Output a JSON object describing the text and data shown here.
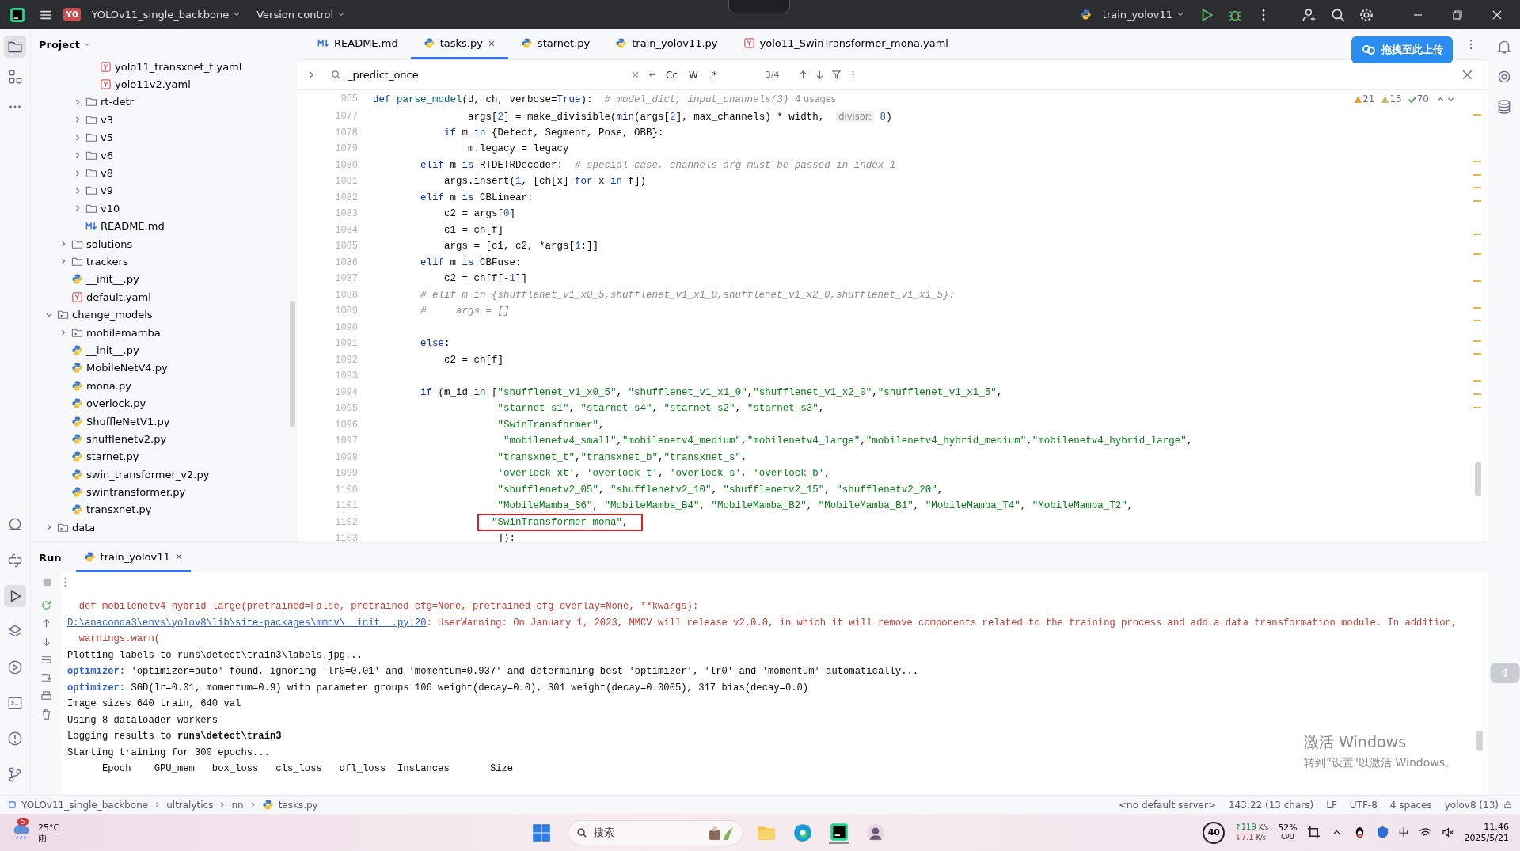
{
  "titlebar": {
    "project_badge": "Y0",
    "project": "YOLOv11_single_backbone",
    "vcs": "Version control",
    "run_config": "train_yolov11"
  },
  "project_panel": {
    "title": "Project",
    "tree": [
      {
        "children": [
          {
            "children": [
              {
                "children": [
                  {
                    "name": "yolo11_transxnet_t.yaml",
                    "kind": "yaml"
                  },
                  {
                    "name": "yolo11v2.yaml",
                    "kind": "yaml"
                  }
                ]
              },
              {
                "name": "rt-detr",
                "kind": "folder",
                "expanded": false
              },
              {
                "name": "v3",
                "kind": "folder",
                "expanded": false
              },
              {
                "name": "v5",
                "kind": "folder",
                "expanded": false
              },
              {
                "name": "v6",
                "kind": "folder",
                "expanded": false
              },
              {
                "name": "v8",
                "kind": "folder",
                "expanded": false
              },
              {
                "name": "v9",
                "kind": "folder",
                "expanded": false
              },
              {
                "name": "v10",
                "kind": "folder",
                "expanded": false
              },
              {
                "name": "README.md",
                "kind": "markdown"
              }
            ]
          },
          {
            "name": "solutions",
            "kind": "folder",
            "expanded": false
          },
          {
            "name": "trackers",
            "kind": "folder",
            "expanded": false
          },
          {
            "name": "__init__.py",
            "kind": "python"
          },
          {
            "name": "default.yaml",
            "kind": "yaml"
          }
        ]
      },
      {
        "name": "change_models",
        "kind": "package",
        "expanded": true,
        "children": [
          {
            "name": "mobilemamba",
            "kind": "package",
            "expanded": false
          },
          {
            "name": "__init__.py",
            "kind": "python"
          },
          {
            "name": "MobileNetV4.py",
            "kind": "python"
          },
          {
            "name": "mona.py",
            "kind": "python"
          },
          {
            "name": "overlock.py",
            "kind": "python"
          },
          {
            "name": "ShuffleNetV1.py",
            "kind": "python"
          },
          {
            "name": "shufflenetv2.py",
            "kind": "python"
          },
          {
            "name": "starnet.py",
            "kind": "python"
          },
          {
            "name": "swin_transformer_v2.py",
            "kind": "python"
          },
          {
            "name": "swintransformer.py",
            "kind": "python"
          },
          {
            "name": "transxnet.py",
            "kind": "python"
          }
        ]
      },
      {
        "name": "data",
        "kind": "package",
        "expanded": false
      }
    ]
  },
  "tabs": [
    {
      "label": "README.md",
      "kind": "markdown",
      "selected": false
    },
    {
      "label": "tasks.py",
      "kind": "python",
      "selected": true
    },
    {
      "label": "starnet.py",
      "kind": "python",
      "selected": false
    },
    {
      "label": "train_yolov11.py",
      "kind": "python",
      "selected": false
    },
    {
      "label": "yolo11_SwinTransformer_mona.yaml",
      "kind": "yaml",
      "selected": false
    }
  ],
  "upload_button": "拖拽至此上传",
  "find": {
    "value": "_predict_once",
    "match_case": "Cc",
    "words": "W",
    "regex": ".*",
    "count": "3/4"
  },
  "inspections": {
    "errors": "21",
    "warnings": "15",
    "typos": "70"
  },
  "sticky_line": {
    "number": "955",
    "tokens": [
      {
        "kind": "k",
        "text": "def "
      },
      {
        "kind": "f",
        "text": "parse_model"
      },
      {
        "kind": "p",
        "text": "(d, ch, verbose="
      },
      {
        "kind": "k",
        "text": "True"
      },
      {
        "kind": "p",
        "text": "):  "
      },
      {
        "kind": "c",
        "text": "# model_dict, input_channels(3)"
      },
      {
        "kind": "u",
        "text": "4 usages"
      }
    ]
  },
  "code_lines": [
    {
      "number": "1077",
      "tokens": [
        {
          "kind": "p",
          "text": "                args["
        },
        {
          "kind": "n",
          "text": "2"
        },
        {
          "kind": "p",
          "text": "] = make_divisible("
        },
        {
          "kind": "b",
          "text": "min"
        },
        {
          "kind": "p",
          "text": "(args["
        },
        {
          "kind": "n",
          "text": "2"
        },
        {
          "kind": "p",
          "text": "], max_channels) * width,  "
        },
        {
          "kind": "h",
          "text": "divisor:"
        },
        {
          "kind": "n",
          "text": " 8"
        },
        {
          "kind": "p",
          "text": ")"
        }
      ]
    },
    {
      "number": "1078",
      "tokens": [
        {
          "kind": "k",
          "text": "            if "
        },
        {
          "kind": "p",
          "text": "m "
        },
        {
          "kind": "k",
          "text": "in "
        },
        {
          "kind": "p",
          "text": "{Detect, Segment, Pose, OBB}:"
        }
      ]
    },
    {
      "number": "1079",
      "tokens": [
        {
          "kind": "p",
          "text": "                m.legacy = legacy"
        }
      ]
    },
    {
      "number": "1080",
      "tokens": [
        {
          "kind": "k",
          "text": "        elif "
        },
        {
          "kind": "p",
          "text": "m "
        },
        {
          "kind": "k",
          "text": "is "
        },
        {
          "kind": "p",
          "text": "RTDETRDecoder:  "
        },
        {
          "kind": "c",
          "text": "# special case, channels arg must be passed in index 1"
        }
      ]
    },
    {
      "number": "1081",
      "tokens": [
        {
          "kind": "p",
          "text": "            args.insert("
        },
        {
          "kind": "n",
          "text": "1"
        },
        {
          "kind": "p",
          "text": ", [ch[x] "
        },
        {
          "kind": "k",
          "text": "for "
        },
        {
          "kind": "p",
          "text": "x "
        },
        {
          "kind": "k",
          "text": "in "
        },
        {
          "kind": "p",
          "text": "f])"
        }
      ]
    },
    {
      "number": "1082",
      "tokens": [
        {
          "kind": "k",
          "text": "        elif "
        },
        {
          "kind": "p",
          "text": "m "
        },
        {
          "kind": "k",
          "text": "is "
        },
        {
          "kind": "p",
          "text": "CBLinear:"
        }
      ]
    },
    {
      "number": "1083",
      "tokens": [
        {
          "kind": "p",
          "text": "            c2 = args["
        },
        {
          "kind": "n",
          "text": "0"
        },
        {
          "kind": "p",
          "text": "]"
        }
      ]
    },
    {
      "number": "1084",
      "tokens": [
        {
          "kind": "p",
          "text": "            c1 = ch[f]"
        }
      ]
    },
    {
      "number": "1085",
      "tokens": [
        {
          "kind": "p",
          "text": "            args = [c1, c2, *args["
        },
        {
          "kind": "n",
          "text": "1"
        },
        {
          "kind": "p",
          "text": ":]]"
        }
      ]
    },
    {
      "number": "1086",
      "tokens": [
        {
          "kind": "k",
          "text": "        elif "
        },
        {
          "kind": "p",
          "text": "m "
        },
        {
          "kind": "k",
          "text": "is "
        },
        {
          "kind": "p",
          "text": "CBFuse:"
        }
      ]
    },
    {
      "number": "1087",
      "tokens": [
        {
          "kind": "p",
          "text": "            c2 = ch[f[-"
        },
        {
          "kind": "n",
          "text": "1"
        },
        {
          "kind": "p",
          "text": "]]"
        }
      ]
    },
    {
      "number": "1088",
      "tokens": [
        {
          "kind": "c",
          "text": "        # elif m in {shufflenet_v1_x0_5,shufflenet_v1_x1_0,shufflenet_v1_x2_0,shufflenet_v1_x1_5}:"
        }
      ]
    },
    {
      "number": "1089",
      "tokens": [
        {
          "kind": "c",
          "text": "        #     args = []"
        }
      ]
    },
    {
      "number": "1090"
    },
    {
      "number": "1091",
      "tokens": [
        {
          "kind": "k",
          "text": "        else"
        },
        {
          "kind": "p",
          "text": ":"
        }
      ]
    },
    {
      "number": "1092",
      "tokens": [
        {
          "kind": "p",
          "text": "            c2 = ch[f]"
        }
      ]
    },
    {
      "number": "1093"
    },
    {
      "number": "1094",
      "tokens": [
        {
          "kind": "k",
          "text": "        if "
        },
        {
          "kind": "p",
          "text": "(m_id "
        },
        {
          "kind": "k",
          "text": "in "
        },
        {
          "kind": "p",
          "text": "["
        },
        {
          "kind": "s",
          "text": "\"shufflenet_v1_x0_5\""
        },
        {
          "kind": "p",
          "text": ", "
        },
        {
          "kind": "s",
          "text": "\"shufflenet_v1_x1_0\""
        },
        {
          "kind": "p",
          "text": ","
        },
        {
          "kind": "s",
          "text": "\"shufflenet_v1_x2_0\""
        },
        {
          "kind": "p",
          "text": ","
        },
        {
          "kind": "s",
          "text": "\"shufflenet_v1_x1_5\""
        },
        {
          "kind": "p",
          "text": ","
        }
      ]
    },
    {
      "number": "1095",
      "tokens": [
        {
          "kind": "s",
          "text": "                     \"starnet_s1\""
        },
        {
          "kind": "p",
          "text": ", "
        },
        {
          "kind": "s",
          "text": "\"starnet_s4\""
        },
        {
          "kind": "p",
          "text": ", "
        },
        {
          "kind": "s",
          "text": "\"starnet_s2\""
        },
        {
          "kind": "p",
          "text": ", "
        },
        {
          "kind": "s",
          "text": "\"starnet_s3\""
        },
        {
          "kind": "p",
          "text": ","
        }
      ]
    },
    {
      "number": "1096",
      "tokens": [
        {
          "kind": "s",
          "text": "                     \"SwinTransformer\""
        },
        {
          "kind": "p",
          "text": ","
        }
      ]
    },
    {
      "number": "1097",
      "tokens": [
        {
          "kind": "s",
          "text": "                      \"mobilenetv4_small\""
        },
        {
          "kind": "p",
          "text": ","
        },
        {
          "kind": "s",
          "text": "\"mobilenetv4_medium\""
        },
        {
          "kind": "p",
          "text": ","
        },
        {
          "kind": "s",
          "text": "\"mobilenetv4_large\""
        },
        {
          "kind": "p",
          "text": ","
        },
        {
          "kind": "s",
          "text": "\"mobilenetv4_hybrid_medium\""
        },
        {
          "kind": "p",
          "text": ","
        },
        {
          "kind": "s",
          "text": "\"mobilenetv4_hybrid_large\""
        },
        {
          "kind": "p",
          "text": ","
        }
      ]
    },
    {
      "number": "1098",
      "tokens": [
        {
          "kind": "s",
          "text": "                     \"transxnet_t\""
        },
        {
          "kind": "p",
          "text": ","
        },
        {
          "kind": "s",
          "text": "\"transxnet_b\""
        },
        {
          "kind": "p",
          "text": ","
        },
        {
          "kind": "s",
          "text": "\"transxnet_s\""
        },
        {
          "kind": "p",
          "text": ","
        }
      ]
    },
    {
      "number": "1099",
      "tokens": [
        {
          "kind": "s",
          "text": "                     'overlock_xt'"
        },
        {
          "kind": "p",
          "text": ", "
        },
        {
          "kind": "s",
          "text": "'overlock_t'"
        },
        {
          "kind": "p",
          "text": ", "
        },
        {
          "kind": "s",
          "text": "'overlock_s'"
        },
        {
          "kind": "p",
          "text": ", "
        },
        {
          "kind": "s",
          "text": "'overlock_b'"
        },
        {
          "kind": "p",
          "text": ","
        }
      ]
    },
    {
      "number": "1100",
      "tokens": [
        {
          "kind": "s",
          "text": "                     \"shufflenetv2_05\""
        },
        {
          "kind": "p",
          "text": ", "
        },
        {
          "kind": "s",
          "text": "\"shufflenetv2_10\""
        },
        {
          "kind": "p",
          "text": ", "
        },
        {
          "kind": "s",
          "text": "\"shufflenetv2_15\""
        },
        {
          "kind": "p",
          "text": ", "
        },
        {
          "kind": "s",
          "text": "\"shufflenetv2_20\""
        },
        {
          "kind": "p",
          "text": ","
        }
      ]
    },
    {
      "number": "1101",
      "tokens": [
        {
          "kind": "s",
          "text": "                     \"MobileMamba_S6\""
        },
        {
          "kind": "p",
          "text": ", "
        },
        {
          "kind": "s",
          "text": "\"MobileMamba_B4\""
        },
        {
          "kind": "p",
          "text": ", "
        },
        {
          "kind": "s",
          "text": "\"MobileMamba_B2\""
        },
        {
          "kind": "p",
          "text": ", "
        },
        {
          "kind": "s",
          "text": "\"MobileMamba_B1\""
        },
        {
          "kind": "p",
          "text": ", "
        },
        {
          "kind": "s",
          "text": "\"MobileMamba_T4\""
        },
        {
          "kind": "p",
          "text": ", "
        },
        {
          "kind": "s",
          "text": "\"MobileMamba_T2\""
        },
        {
          "kind": "p",
          "text": ","
        }
      ]
    },
    {
      "number": "1102",
      "highlighted": true,
      "tokens": [
        {
          "kind": "s",
          "text": "\"SwinTransformer_mona\""
        },
        {
          "kind": "p",
          "text": ","
        }
      ]
    },
    {
      "number": "1103",
      "tokens": [
        {
          "kind": "p",
          "text": "                     ]):"
        }
      ]
    }
  ],
  "run_panel": {
    "title": "Run",
    "tabs": [
      {
        "label": "train_yolov11",
        "selected": true
      }
    ],
    "output": [
      {
        "tokens": [
          {
            "kind": "e",
            "text": "  def mobilenetv4_hybrid_large(pretrained=False, pretrained_cfg=None, pretrained_cfg_overlay=None, **kwargs):"
          }
        ]
      },
      {
        "tokens": [
          {
            "kind": "l",
            "text": "D:\\anaconda3\\envs\\yolov8\\lib\\site-packages\\mmcv\\__init__.py:20"
          },
          {
            "kind": "e",
            "text": ": UserWarning: On January 1, 2023, MMCV will release v2.0.0, in which it will remove components related to the training process and add a data transformation module. In addition,"
          }
        ]
      },
      {
        "tokens": [
          {
            "kind": "e",
            "text": "  warnings.warn("
          }
        ]
      },
      {
        "tokens": [
          {
            "kind": "p",
            "text": "Plotting labels to runs\\detect\\train3\\labels.jpg... "
          }
        ]
      },
      {
        "tokens": [
          {
            "kind": "o",
            "text": "optimizer:"
          },
          {
            "kind": "p",
            "text": " 'optimizer=auto' found, ignoring 'lr0=0.01' and 'momentum=0.937' and determining best 'optimizer', 'lr0' and 'momentum' automatically... "
          }
        ]
      },
      {
        "tokens": [
          {
            "kind": "o",
            "text": "optimizer:"
          },
          {
            "kind": "p",
            "text": " SGD(lr=0.01, momentum=0.9) with parameter groups 106 weight(decay=0.0), 301 weight(decay=0.0005), 317 bias(decay=0.0)"
          }
        ]
      },
      {
        "tokens": [
          {
            "kind": "p",
            "text": "Image sizes 640 train, 640 val"
          }
        ]
      },
      {
        "tokens": [
          {
            "kind": "p",
            "text": "Using 8 dataloader workers"
          }
        ]
      },
      {
        "tokens": [
          {
            "kind": "p",
            "text": "Logging results to "
          },
          {
            "kind": "w",
            "text": "runs\\detect\\train3"
          }
        ]
      },
      {
        "tokens": [
          {
            "kind": "p",
            "text": "Starting training for 300 epochs..."
          }
        ]
      },
      {
        "tokens": [
          {
            "kind": "p",
            "text": "      Epoch    GPU_mem   box_loss   cls_loss   dfl_loss  Instances       Size"
          }
        ]
      }
    ]
  },
  "activation": {
    "title": "激活 Windows",
    "hint": "转到\"设置\"以激活 Windows。"
  },
  "status_bar": {
    "breadcrumbs": [
      "YOLOv11_single_backbone",
      "ultralytics",
      "nn",
      "tasks.py"
    ],
    "items": [
      "<no default server>",
      "143:22 (13 chars)",
      "LF",
      "UTF-8",
      "4 spaces",
      "yolov8 (13)"
    ]
  },
  "taskbar": {
    "weather_badge": "5",
    "temperature": "25°C",
    "condition": "雨",
    "search": "搜索",
    "meter": "40",
    "upload": "↑119",
    "upload_unit": "K/s",
    "download": "↓7.1",
    "download_unit": "K/s",
    "cpu": "52%",
    "cpu_label": "CPU",
    "ime": "中",
    "time": "11:46",
    "date": "2025/5/21"
  }
}
